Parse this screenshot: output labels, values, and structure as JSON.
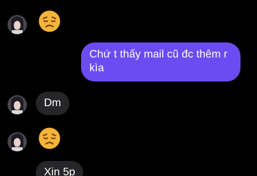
{
  "chat": {
    "messages": [
      {
        "sender": "them",
        "kind": "emoji",
        "emoji": "disappointed-face"
      },
      {
        "sender": "me",
        "kind": "text",
        "text": "Chứ t thấy mail cũ đc thêm r kìa"
      },
      {
        "sender": "them",
        "kind": "text",
        "text": "Dm"
      },
      {
        "sender": "them",
        "kind": "emoji",
        "emoji": "disappointed-face"
      },
      {
        "sender": "them",
        "kind": "text",
        "text": "Xin 5p"
      }
    ]
  },
  "colors": {
    "background": "#000000",
    "outgoing_bubble": "#6a4cf2",
    "incoming_bubble": "#262629",
    "text": "#ffffff"
  }
}
